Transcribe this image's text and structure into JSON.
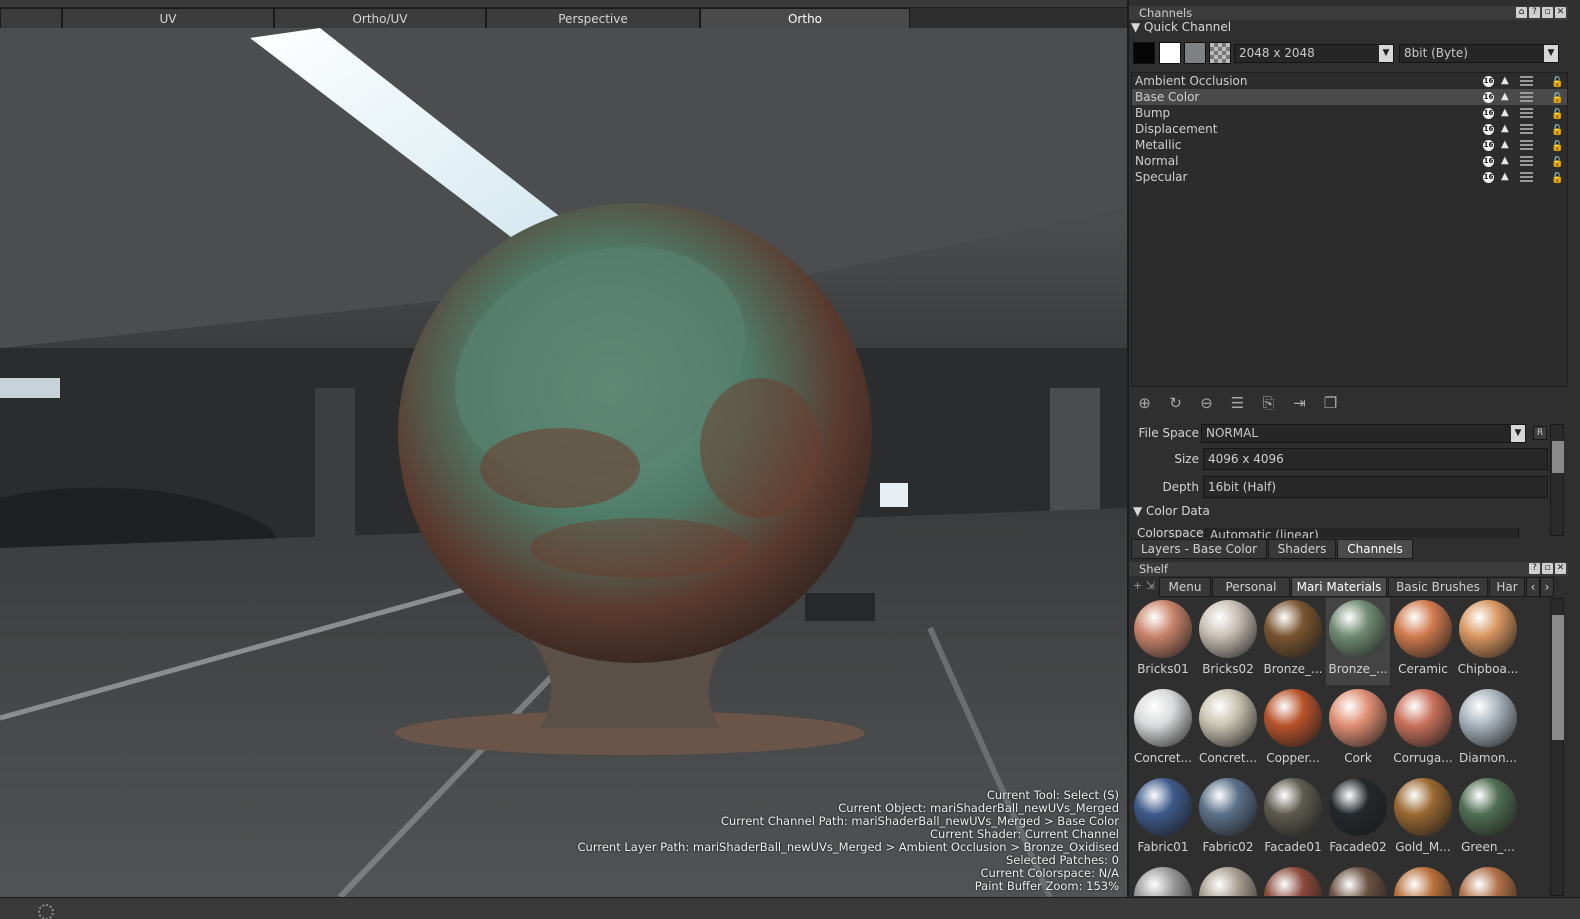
{
  "viewport_tabs": [
    "",
    "UV",
    "Ortho/UV",
    "Perspective",
    "Ortho"
  ],
  "hud": [
    "Current Tool: Select (S)",
    "Current Object: mariShaderBall_newUVs_Merged",
    "Current Channel Path: mariShaderBall_newUVs_Merged > Base Color",
    "Current Shader: Current Channel",
    "Current Layer Path: mariShaderBall_newUVs_Merged > Ambient Occlusion > Bronze_Oxidised",
    "Selected Patches: 0",
    "Current Colorspace: N/A",
    "Paint Buffer Zoom: 153%"
  ],
  "channels_panel": {
    "title": "Channels",
    "quick_channel": "Quick Channel",
    "size_value": "2048 x 2048",
    "depth_value": "8bit  (Byte)",
    "badge": "16",
    "channels": [
      "Ambient Occlusion",
      "Base Color",
      "Bump",
      "Displacement",
      "Metallic",
      "Normal",
      "Specular"
    ],
    "selected": "Base Color",
    "file_space_label": "File Space",
    "file_space_value": "NORMAL",
    "size_label": "Size",
    "size_prop": "4096 x 4096",
    "depth_label": "Depth",
    "depth_prop": "16bit (Half)",
    "color_data": "Color Data",
    "colorspace_label": "Colorspace",
    "colorspace_value": "Automatic (linear)",
    "r_label": "R"
  },
  "panel_tabs": [
    "Layers - Base Color",
    "Shaders",
    "Channels"
  ],
  "shelf": {
    "title": "Shelf",
    "tabs": [
      "Menu",
      "Personal",
      "Mari Materials",
      "Basic Brushes",
      "Har"
    ],
    "materials": [
      {
        "label": "Bricks01",
        "color": "#c9846a"
      },
      {
        "label": "Bricks02",
        "color": "#c8bfb4"
      },
      {
        "label": "Bronze_...",
        "color": "#7a5530"
      },
      {
        "label": "Bronze_...",
        "color": "#6f8a72"
      },
      {
        "label": "Ceramic",
        "color": "#d07a4e"
      },
      {
        "label": "Chipboa...",
        "color": "#d99660"
      },
      {
        "label": "Concret...",
        "color": "#d9dadb"
      },
      {
        "label": "Concret...",
        "color": "#c9c2b0"
      },
      {
        "label": "Copper...",
        "color": "#b8532a"
      },
      {
        "label": "Cork",
        "color": "#e08f73"
      },
      {
        "label": "Corruga...",
        "color": "#c9705a"
      },
      {
        "label": "Diamon...",
        "color": "#a9b4bd"
      },
      {
        "label": "Fabric01",
        "color": "#3e5a8a"
      },
      {
        "label": "Fabric02",
        "color": "#5a7088"
      },
      {
        "label": "Facade01",
        "color": "#5e5a50"
      },
      {
        "label": "Facade02",
        "color": "#23282c"
      },
      {
        "label": "Gold_M...",
        "color": "#9a6830"
      },
      {
        "label": "Green_...",
        "color": "#4f6e52"
      },
      {
        "label": "",
        "color": "#9a9a9a"
      },
      {
        "label": "",
        "color": "#a89e90"
      },
      {
        "label": "",
        "color": "#8a4a3a"
      },
      {
        "label": "",
        "color": "#6a5040"
      },
      {
        "label": "",
        "color": "#b8703a"
      },
      {
        "label": "",
        "color": "#b07048"
      }
    ],
    "selected_index": 3
  },
  "colors": {
    "accent_selected": "#4a4a4a",
    "panel_bg": "#2f2f2f",
    "patina": "#5e8a74",
    "rust": "#6e3a2c"
  }
}
